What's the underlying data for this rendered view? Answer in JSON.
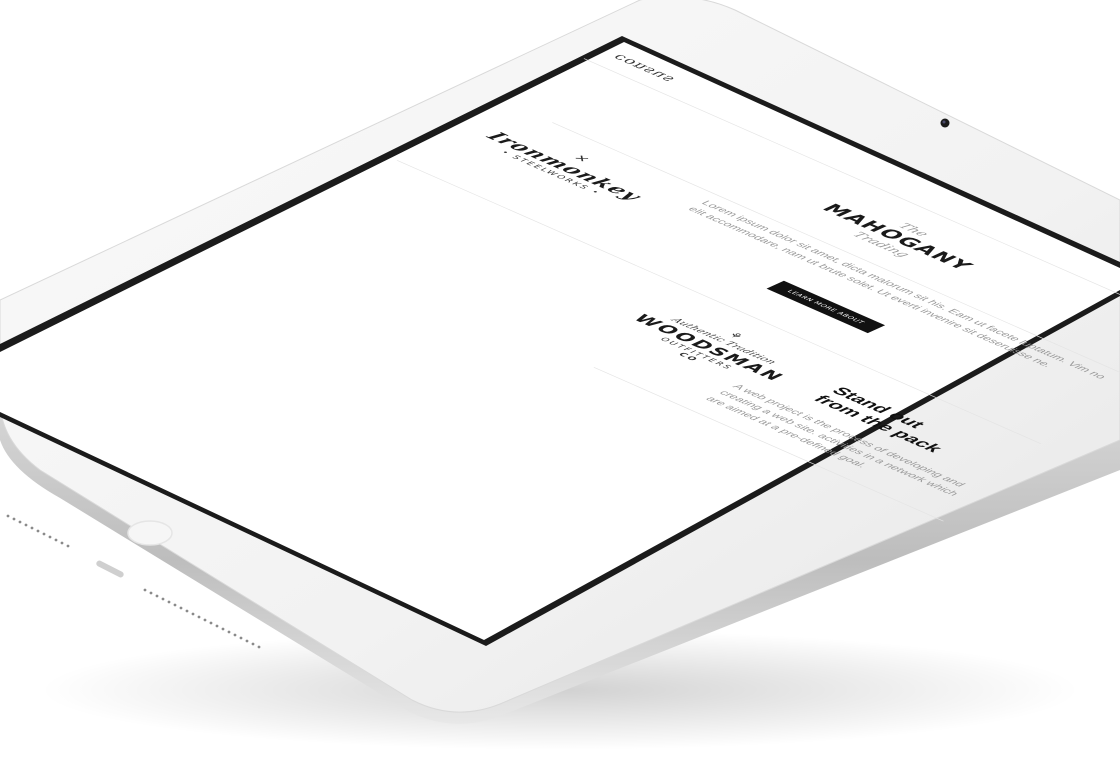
{
  "site": {
    "logo": "consus"
  },
  "brands": {
    "mahogany": {
      "top": "The",
      "main": "MAHOGANY",
      "bottom": "Trading"
    },
    "ironmonkey": {
      "main": "Ironmonkey",
      "sub": "• STEELWORKS •"
    },
    "woodsman": {
      "top": "Authentic Tradition",
      "main": "WOODSMAN",
      "sub": "OUTFITTERS",
      "bottom": "CO"
    }
  },
  "intro": {
    "text": "Lorem ipsum dolor sit amet, dicta malorum sit his. Eam ut facete luptatum. Vim no elit accommodare, nam ut brute solet. Ut everti invenire sit deseruisse ne.",
    "button_label": "LEARN MORE ABOUT"
  },
  "feature": {
    "heading_line1": "Stand out",
    "heading_line2": "from the pack",
    "text": "A web project is the process of developing and creating a web site. activities in a network which are aimed at a pre-defined goal."
  }
}
